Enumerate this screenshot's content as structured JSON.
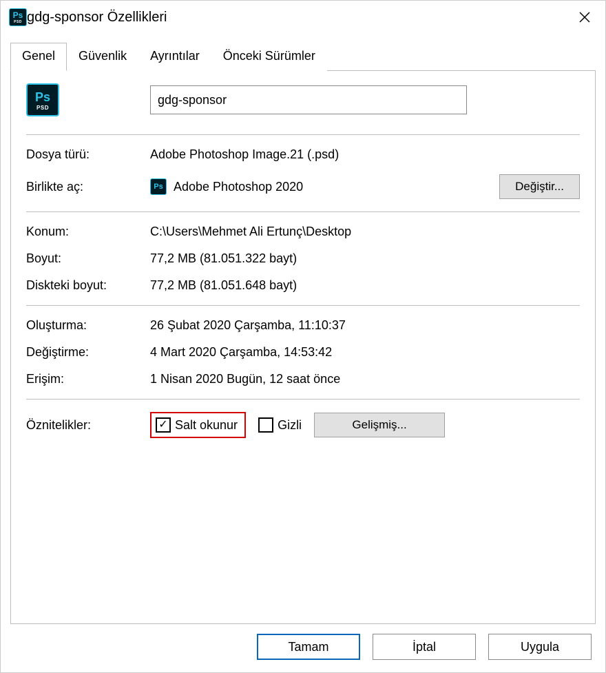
{
  "titlebar": {
    "title": "gdg-sponsor Özellikleri"
  },
  "tabs": {
    "general": "Genel",
    "security": "Güvenlik",
    "details": "Ayrıntılar",
    "previous": "Önceki Sürümler"
  },
  "general": {
    "filename": "gdg-sponsor",
    "file_type_label": "Dosya türü:",
    "file_type_value": "Adobe Photoshop Image.21 (.psd)",
    "opens_with_label": "Birlikte aç:",
    "opens_with_value": "Adobe Photoshop 2020",
    "change_button": "Değiştir...",
    "location_label": "Konum:",
    "location_value": "C:\\Users\\Mehmet Ali Ertunç\\Desktop",
    "size_label": "Boyut:",
    "size_value": "77,2 MB (81.051.322 bayt)",
    "size_on_disk_label": "Diskteki boyut:",
    "size_on_disk_value": "77,2 MB (81.051.648 bayt)",
    "created_label": "Oluşturma:",
    "created_value": "26 Şubat 2020 Çarşamba, 11:10:37",
    "modified_label": "Değiştirme:",
    "modified_value": "4 Mart 2020 Çarşamba, 14:53:42",
    "accessed_label": "Erişim:",
    "accessed_value": "1 Nisan 2020 Bugün, 12 saat önce",
    "attributes_label": "Öznitelikler:",
    "readonly_label": "Salt okunur",
    "readonly_checked": true,
    "hidden_label": "Gizli",
    "hidden_checked": false,
    "advanced_button": "Gelişmiş..."
  },
  "footer": {
    "ok": "Tamam",
    "cancel": "İptal",
    "apply": "Uygula"
  }
}
